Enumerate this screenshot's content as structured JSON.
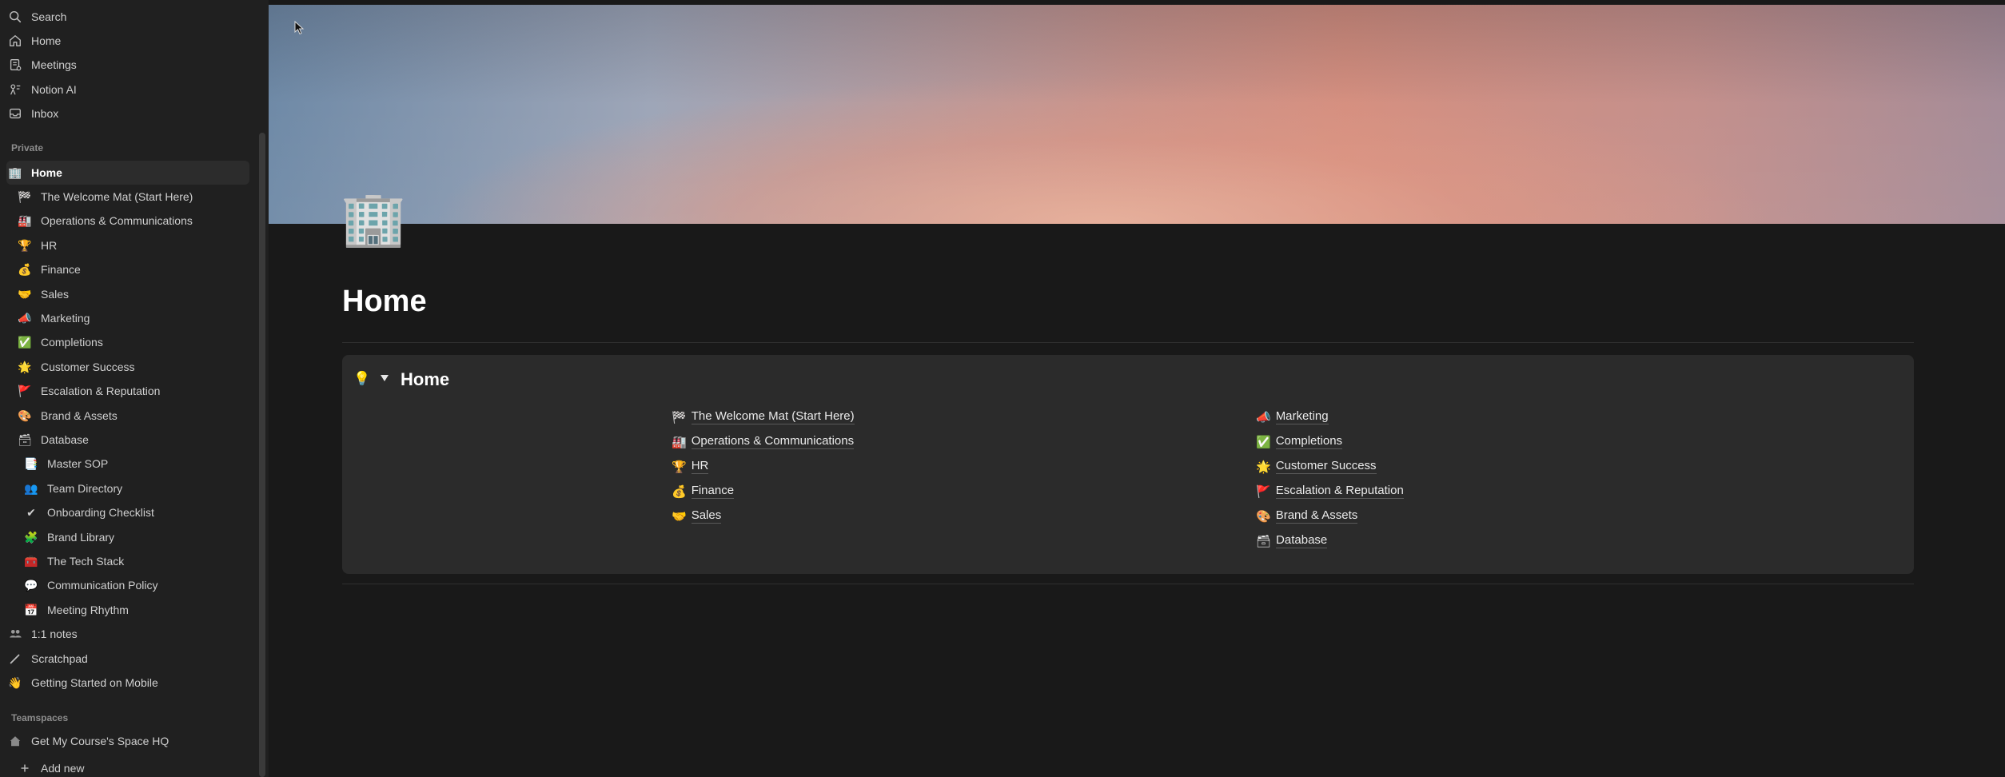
{
  "sidebar": {
    "top_items": [
      {
        "label": "Search",
        "icon": "search-icon"
      },
      {
        "label": "Home",
        "icon": "house-icon"
      },
      {
        "label": "Meetings",
        "icon": "meetings-icon"
      },
      {
        "label": "Notion AI",
        "icon": "notion-ai-icon"
      },
      {
        "label": "Inbox",
        "icon": "inbox-icon"
      }
    ],
    "private_label": "Private",
    "private_items": [
      {
        "label": "Home",
        "emoji": "🏢",
        "selected": true
      },
      {
        "label": "The Welcome Mat (Start Here)",
        "emoji": "🏁"
      },
      {
        "label": "Operations & Communications",
        "emoji": "🏭"
      },
      {
        "label": "HR",
        "emoji": "🏆"
      },
      {
        "label": "Finance",
        "emoji": "💰"
      },
      {
        "label": "Sales",
        "emoji": "🤝"
      },
      {
        "label": "Marketing",
        "emoji": "📣"
      },
      {
        "label": "Completions",
        "emoji": "✅"
      },
      {
        "label": "Customer Success",
        "emoji": "🌟"
      },
      {
        "label": "Escalation & Reputation",
        "emoji": "🚩"
      },
      {
        "label": "Brand & Assets",
        "emoji": "🎨"
      },
      {
        "label": "Database",
        "emoji": "🗃"
      },
      {
        "label": "Master SOP",
        "emoji": "📑"
      },
      {
        "label": "Team Directory",
        "emoji": "👥"
      },
      {
        "label": "Onboarding Checklist",
        "emoji": "✔"
      },
      {
        "label": "Brand Library",
        "emoji": "🧩"
      },
      {
        "label": "The Tech Stack",
        "emoji": "🧰"
      },
      {
        "label": "Communication Policy",
        "emoji": "💬"
      },
      {
        "label": "Meeting Rhythm",
        "emoji": "📅"
      },
      {
        "label": "1:1 notes",
        "icon": "people-icon"
      },
      {
        "label": "Scratchpad",
        "icon": "pencil-icon"
      },
      {
        "label": "Getting Started on Mobile",
        "emoji": "👋"
      }
    ],
    "teamspaces_label": "Teamspaces",
    "teamspace_items": [
      {
        "label": "Get My Course's Space HQ",
        "icon": "house-icon"
      },
      {
        "label": "Add new",
        "icon": "plus-icon"
      }
    ]
  },
  "page": {
    "icon": "🏢",
    "title": "Home",
    "callout": {
      "icon": "💡",
      "heading": "Home",
      "left_links": [
        {
          "emoji": "🏁",
          "label": "The Welcome Mat (Start Here)"
        },
        {
          "emoji": "🏭",
          "label": "Operations & Communications"
        },
        {
          "emoji": "🏆",
          "label": "HR"
        },
        {
          "emoji": "💰",
          "label": "Finance"
        },
        {
          "emoji": "🤝",
          "label": "Sales"
        }
      ],
      "right_links": [
        {
          "emoji": "📣",
          "label": "Marketing"
        },
        {
          "emoji": "✅",
          "label": "Completions"
        },
        {
          "emoji": "🌟",
          "label": "Customer Success"
        },
        {
          "emoji": "🚩",
          "label": "Escalation & Reputation"
        },
        {
          "emoji": "🎨",
          "label": "Brand & Assets"
        },
        {
          "emoji": "🗃",
          "label": "Database"
        }
      ]
    }
  },
  "colors": {
    "sidebar_bg": "#202020",
    "main_bg": "#191919",
    "callout_bg": "#2b2b2b"
  }
}
